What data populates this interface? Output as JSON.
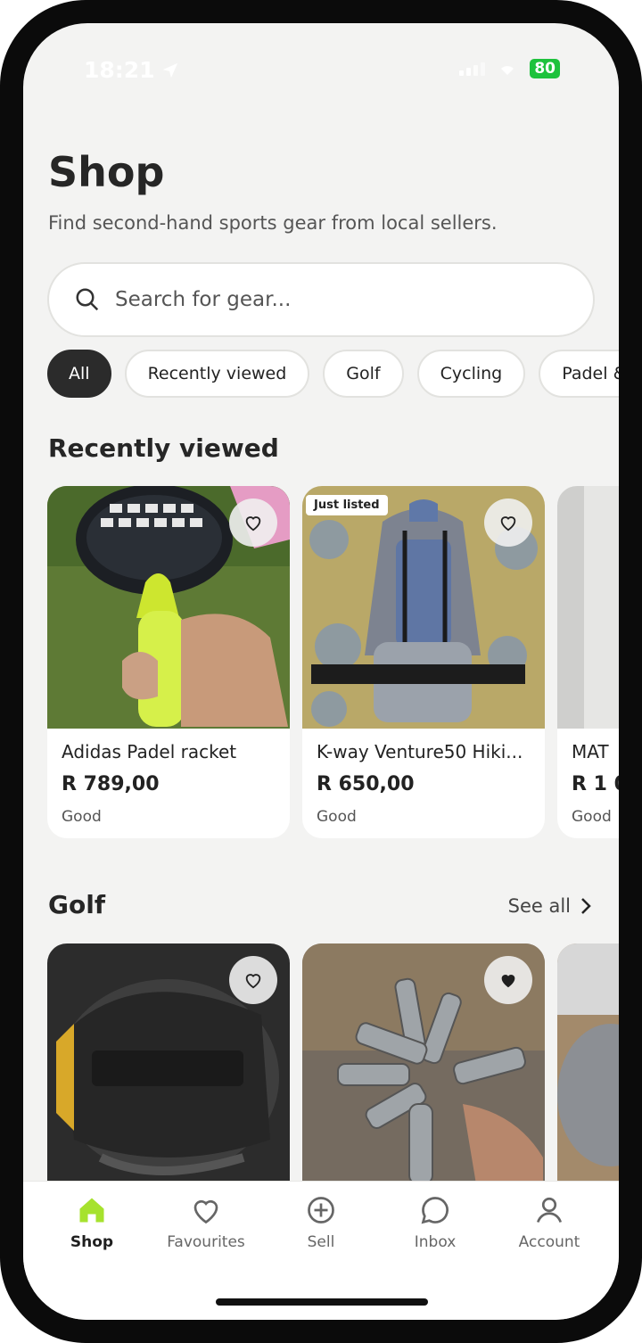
{
  "status": {
    "time": "18:21",
    "battery": "80"
  },
  "page": {
    "title": "Shop",
    "subtitle": "Find second-hand sports gear from local sellers."
  },
  "search": {
    "placeholder": "Search for gear..."
  },
  "chips": [
    "All",
    "Recently viewed",
    "Golf",
    "Cycling",
    "Padel &"
  ],
  "recently_viewed": {
    "title": "Recently viewed",
    "items": [
      {
        "name": "Adidas Padel racket",
        "price": "R 789,00",
        "condition": "Good",
        "badge": ""
      },
      {
        "name": "K-way Venture50 Hiki...",
        "price": "R 650,00",
        "condition": "Good",
        "badge": "Just listed"
      },
      {
        "name": "MAT",
        "price": "R 1 0",
        "condition": "Good",
        "badge": ""
      }
    ]
  },
  "golf": {
    "title": "Golf",
    "see_all": "See all"
  },
  "nav": {
    "shop": "Shop",
    "favourites": "Favourites",
    "sell": "Sell",
    "inbox": "Inbox",
    "account": "Account"
  },
  "colors": {
    "accent": "#a6e22e",
    "chip_active": "#2b2b2b",
    "battery": "#1ec23d"
  }
}
